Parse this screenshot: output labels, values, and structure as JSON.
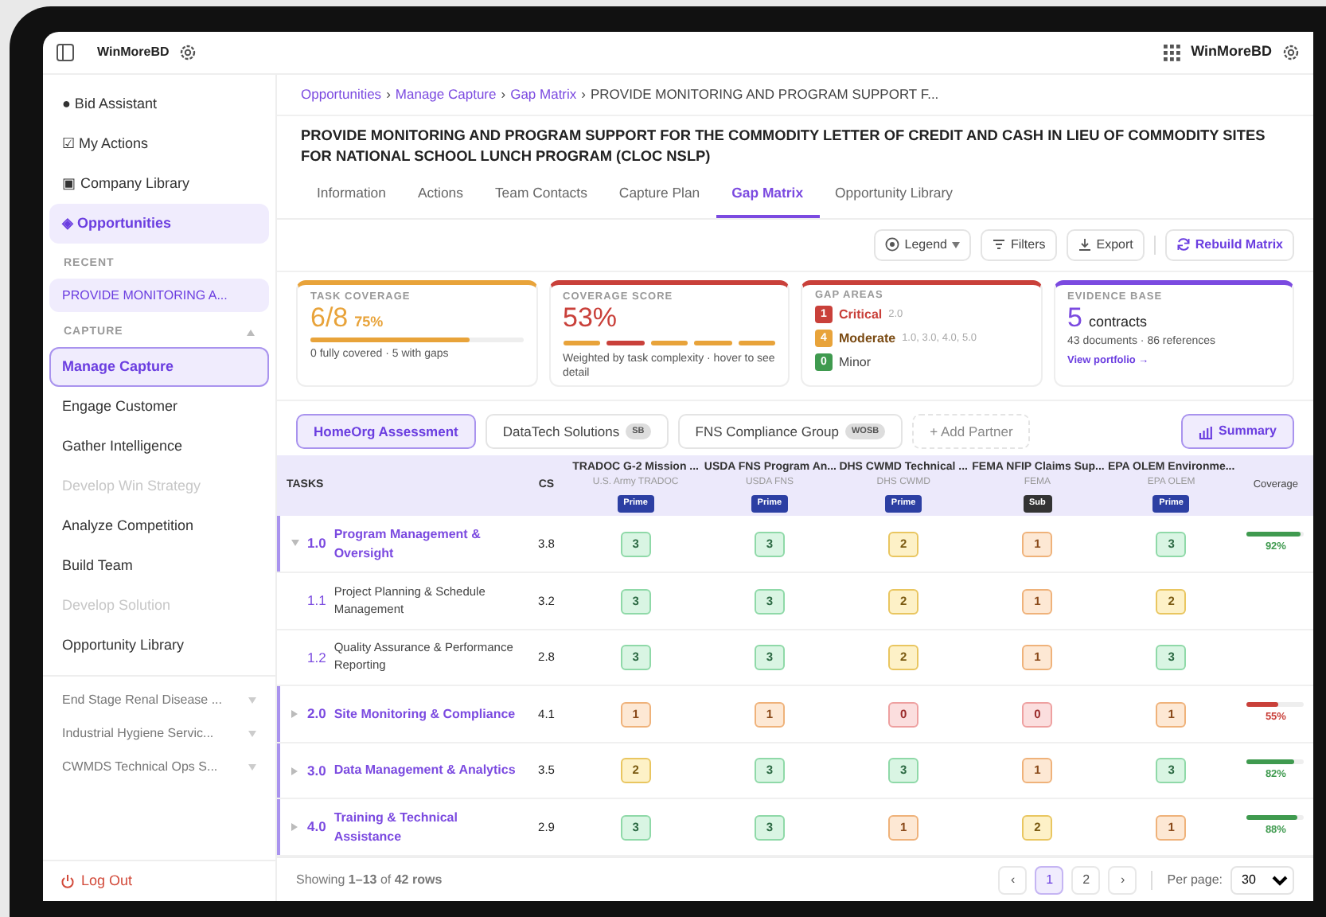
{
  "topbar": {
    "brand": "WinMoreBD",
    "account": "WinMoreBD"
  },
  "sidebar": {
    "nav": [
      {
        "icon": "●",
        "label": "Bid Assistant",
        "selected": false
      },
      {
        "icon": "☑",
        "label": "My Actions",
        "selected": false
      },
      {
        "icon": "▣",
        "label": "Company Library",
        "selected": false
      },
      {
        "icon": "◈",
        "label": "Opportunities",
        "selected": true
      }
    ],
    "recent_label": "RECENT",
    "recent": [
      "PROVIDE MONITORING A..."
    ],
    "capture_label": "CAPTURE",
    "capture": [
      {
        "label": "Manage Capture",
        "selected": true,
        "disabled": false
      },
      {
        "label": "Engage Customer",
        "selected": false,
        "disabled": false
      },
      {
        "label": "Gather Intelligence",
        "selected": false,
        "disabled": false
      },
      {
        "label": "Develop Win Strategy",
        "selected": false,
        "disabled": true
      },
      {
        "label": "Analyze Competition",
        "selected": false,
        "disabled": false
      },
      {
        "label": "Build Team",
        "selected": false,
        "disabled": false
      },
      {
        "label": "Develop Solution",
        "selected": false,
        "disabled": true
      },
      {
        "label": "Opportunity Library",
        "selected": false,
        "disabled": false
      }
    ],
    "other": [
      "End Stage Renal Disease ...",
      "Industrial Hygiene Servic...",
      "CWMDS Technical Ops S..."
    ],
    "logout": "Log Out"
  },
  "breadcrumb": [
    {
      "label": "Opportunities",
      "link": true
    },
    {
      "separator": "›",
      "label": "Manage Capture",
      "link": true
    },
    {
      "separator": "›",
      "label": "Gap Matrix",
      "link": true
    },
    {
      "separator": "›",
      "label": "PROVIDE MONITORING AND PROGRAM SUPPORT F...",
      "link": false
    }
  ],
  "title": "PROVIDE MONITORING AND PROGRAM SUPPORT FOR THE COMMODITY LETTER OF CREDIT AND CASH IN LIEU OF COMMODITY SITES FOR NATIONAL SCHOOL LUNCH PROGRAM (CLOC NSLP)",
  "tabs": [
    {
      "label": "Information",
      "selected": false
    },
    {
      "label": "Actions",
      "selected": false
    },
    {
      "label": "Team Contacts",
      "selected": false
    },
    {
      "label": "Capture Plan",
      "selected": false
    },
    {
      "label": "Gap Matrix",
      "selected": true
    },
    {
      "label": "Opportunity Library",
      "selected": false
    }
  ],
  "toolbar": [
    {
      "kind": "legend",
      "label": "Legend"
    },
    {
      "kind": "filters",
      "label": "Filters"
    },
    {
      "kind": "export",
      "label": "Export"
    },
    {
      "kind": "rebuild",
      "label": "Rebuild Matrix"
    }
  ],
  "cards": [
    {
      "kind": "coverage",
      "title": "TASK COVERAGE",
      "color": "#e8a33a",
      "value": "6/8",
      "percent": "75%",
      "level": 0.75,
      "note": "0 fully covered · 5 with gaps"
    },
    {
      "kind": "score",
      "title": "COVERAGE SCORE",
      "color": "#c9403a",
      "value": "53%",
      "segments": [
        {
          "color": "#e8a33a"
        },
        {
          "color": "#c9403a"
        },
        {
          "color": "#e8a33a"
        },
        {
          "color": "#e8a33a"
        },
        {
          "color": "#e8a33a"
        }
      ],
      "note": "Weighted by task complexity · hover to see detail"
    },
    {
      "kind": "gaps",
      "title": "GAP AREAS",
      "color": "#c9403a",
      "gaps": [
        {
          "count": "1",
          "label": "Critical",
          "tasks": "2.0",
          "color": "#c9403a"
        },
        {
          "count": "4",
          "label": "Moderate",
          "tasks": "1.0, 3.0, 4.0, 5.0",
          "color": "#e8a33a"
        },
        {
          "count": "0",
          "label": "Minor",
          "color": "#3f9a4f"
        }
      ]
    },
    {
      "kind": "evidence",
      "title": "EVIDENCE BASE",
      "color": "#7b4ae0",
      "value": "5",
      "unit": "contracts",
      "note": "43 documents · 86 references",
      "link": "View portfolio →"
    }
  ],
  "partners": [
    {
      "label": "HomeOrg Assessment",
      "selected": true
    },
    {
      "label": "DataTech Solutions",
      "badge": "SB",
      "selected": false
    },
    {
      "label": "FNS Compliance Group",
      "badge": "WOSB",
      "selected": false
    }
  ],
  "add_partner": "+ Add Partner",
  "summary": "Summary",
  "table": {
    "tasks_header": "TASKS",
    "cs_header": "CS",
    "coverage_header": "Coverage",
    "contracts": [
      {
        "title": "TRADOC G-2 Mission ...",
        "agency": "U.S. Army TRADOC",
        "role": "Prime"
      },
      {
        "title": "USDA FNS Program An...",
        "agency": "USDA FNS",
        "role": "Prime"
      },
      {
        "title": "DHS CWMD Technical ...",
        "agency": "DHS CWMD",
        "role": "Prime"
      },
      {
        "title": "FEMA NFIP Claims Sup...",
        "agency": "FEMA",
        "role": "Sub"
      },
      {
        "title": "EPA OLEM Environme...",
        "agency": "EPA OLEM",
        "role": "Prime"
      }
    ],
    "rows": [
      {
        "kind": "parent",
        "expanded": true,
        "number": "1.0",
        "name": "Program Management & Oversight",
        "cs": "3.8",
        "scores": [
          "3",
          "3",
          "2",
          "1",
          "3"
        ],
        "coverage": {
          "level": 0.92,
          "reading": "92%",
          "color": "#3f9a4f"
        }
      },
      {
        "kind": "child",
        "number": "1.1",
        "name": "Project Planning & Schedule Management",
        "cs": "3.2",
        "scores": [
          "3",
          "3",
          "2",
          "1",
          "2"
        ]
      },
      {
        "kind": "child",
        "number": "1.2",
        "name": "Quality Assurance & Performance Reporting",
        "cs": "2.8",
        "scores": [
          "3",
          "3",
          "2",
          "1",
          "3"
        ]
      },
      {
        "kind": "parent",
        "expanded": false,
        "number": "2.0",
        "name": "Site Monitoring & Compliance",
        "cs": "4.1",
        "scores": [
          "1",
          "1",
          "0",
          "0",
          "1"
        ],
        "coverage": {
          "level": 0.55,
          "reading": "55%",
          "color": "#c9403a"
        }
      },
      {
        "kind": "parent",
        "expanded": false,
        "number": "3.0",
        "name": "Data Management & Analytics",
        "cs": "3.5",
        "scores": [
          "2",
          "3",
          "3",
          "1",
          "3"
        ],
        "coverage": {
          "level": 0.82,
          "reading": "82%",
          "color": "#3f9a4f"
        }
      },
      {
        "kind": "parent",
        "expanded": false,
        "number": "4.0",
        "name": "Training & Technical Assistance",
        "cs": "2.9",
        "scores": [
          "3",
          "3",
          "1",
          "2",
          "1"
        ],
        "coverage": {
          "level": 0.88,
          "reading": "88%",
          "color": "#3f9a4f"
        }
      }
    ]
  },
  "footer": {
    "showing": "Showing **1–13** of **42 rows**",
    "pages": [
      {
        "label": "‹",
        "selected": false
      },
      {
        "label": "1",
        "selected": true
      },
      {
        "label": "2",
        "selected": false
      },
      {
        "label": "›",
        "selected": false
      }
    ],
    "per_page_label": "Per page:",
    "per_page": "30"
  }
}
